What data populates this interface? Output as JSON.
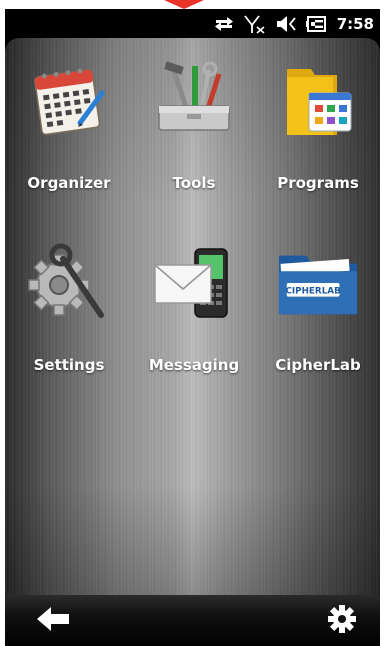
{
  "status_bar": {
    "time": "7:58",
    "icons": [
      "data-transfer-icon",
      "no-signal-icon",
      "volume-muted-icon",
      "battery-charging-icon"
    ]
  },
  "home": {
    "tiles": [
      {
        "label": "Organizer",
        "icon": "calendar-icon"
      },
      {
        "label": "Tools",
        "icon": "toolbox-icon"
      },
      {
        "label": "Programs",
        "icon": "programs-folder-icon"
      },
      {
        "label": "Settings",
        "icon": "settings-gears-icon"
      },
      {
        "label": "Messaging",
        "icon": "envelope-phone-icon"
      },
      {
        "label": "CipherLab",
        "icon": "cipherlab-folder-icon",
        "badge": "CIPHERLAB"
      }
    ]
  },
  "bottom_bar": {
    "back_icon": "back-arrow-icon",
    "settings_icon": "gear-icon"
  },
  "colors": {
    "accent_notch": "#e8322a",
    "folder_yellow": "#f2c11a",
    "cipher_blue": "#2f6fb6"
  }
}
